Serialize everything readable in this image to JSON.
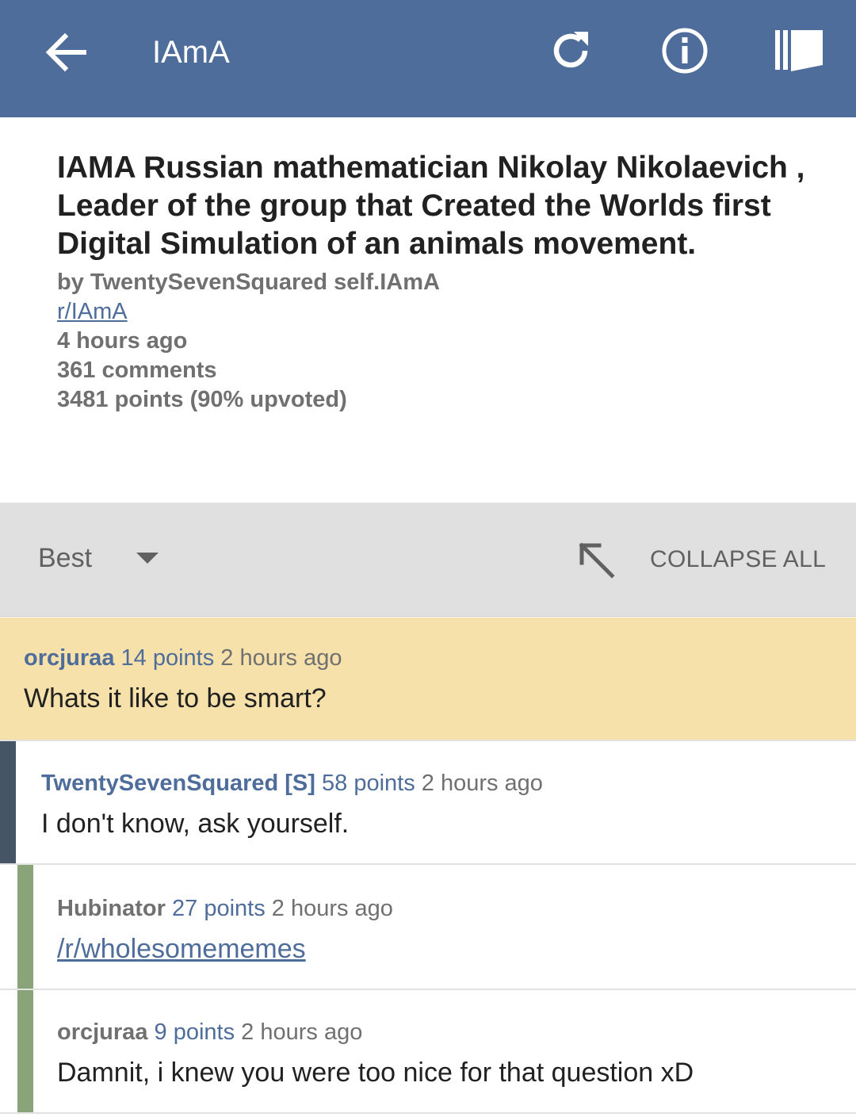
{
  "toolbar": {
    "title": "IAmA",
    "back_icon": "arrow-back-icon",
    "refresh_icon": "refresh-icon",
    "info_icon": "info-icon",
    "sidebar_icon": "sidebar-icon",
    "background_color": "#4f6d9a"
  },
  "post": {
    "title": "IAMA Russian mathematician Nikolay Nikolaevich , Leader of the group that Created the Worlds first Digital Simulation of an animals movement.",
    "byline": "by TwentySevenSquared self.IAmA",
    "subreddit": "r/IAmA",
    "age": "4 hours ago",
    "comments": "361 comments",
    "points": "3481 points (90% upvoted)"
  },
  "sort": {
    "label": "Best",
    "dropdown_icon": "dropdown-arrow-icon",
    "collapse_icon": "collapse-arrow-icon",
    "collapse_label": "COLLAPSE ALL"
  },
  "comments": [
    {
      "author": "orcjuraa",
      "points": "14 points",
      "time": "2 hours ago",
      "body": "Whats it like to be smart?",
      "highlight_color": "#f6e1aa"
    },
    {
      "author": "TwentySevenSquared [S]",
      "points": "58 points",
      "time": "2 hours ago",
      "body": "I don't know, ask yourself.",
      "depth_color": "#455565"
    },
    {
      "author": "Hubinator",
      "points": "27 points",
      "time": "2 hours ago",
      "body": "/r/wholesomememes",
      "depth_color": "#88a478"
    },
    {
      "author": "orcjuraa",
      "points": "9 points",
      "time": "2 hours ago",
      "body": "Damnit, i knew you were too nice for that question xD",
      "depth_color": "#88a478"
    }
  ]
}
